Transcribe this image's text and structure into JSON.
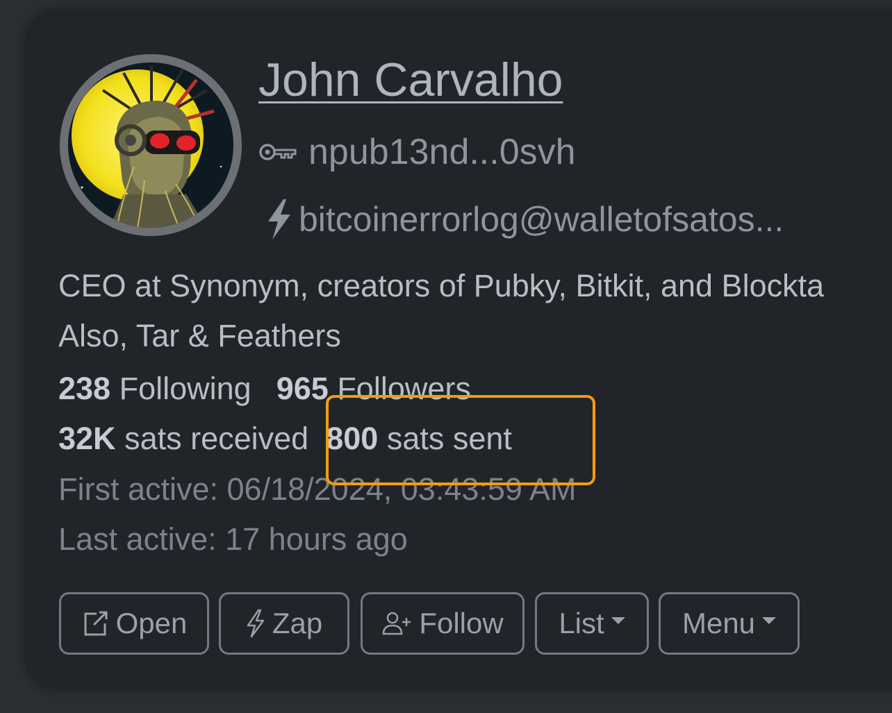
{
  "profile": {
    "name": "John Carvalho",
    "npub": "npub13nd...0svh",
    "lightning": "bitcoinerrorlog@walletofsatos...",
    "about_line1": "CEO at Synonym, creators of Pubky, Bitkit, and Blockta",
    "about_line2": "Also, Tar & Feathers"
  },
  "stats": {
    "following_count": "238",
    "following_label": "Following",
    "followers_count": "965",
    "followers_label": "Followers",
    "sats_received_count": "32K",
    "sats_received_label": "sats received",
    "sats_sent_count": "800",
    "sats_sent_label": "sats sent"
  },
  "activity": {
    "first_active": "First active: 06/18/2024, 03:43:59 AM",
    "last_active": "Last active: 17 hours ago"
  },
  "buttons": {
    "open": "Open",
    "zap": "Zap",
    "follow": "Follow",
    "list": "List",
    "menu": "Menu"
  },
  "icons": {
    "npub": "key-icon",
    "lightning": "lightning-icon",
    "open": "external-link-icon",
    "zap": "zap-icon",
    "follow": "person-plus-icon"
  },
  "colors": {
    "highlight": "#f39c12",
    "background": "#212529"
  }
}
